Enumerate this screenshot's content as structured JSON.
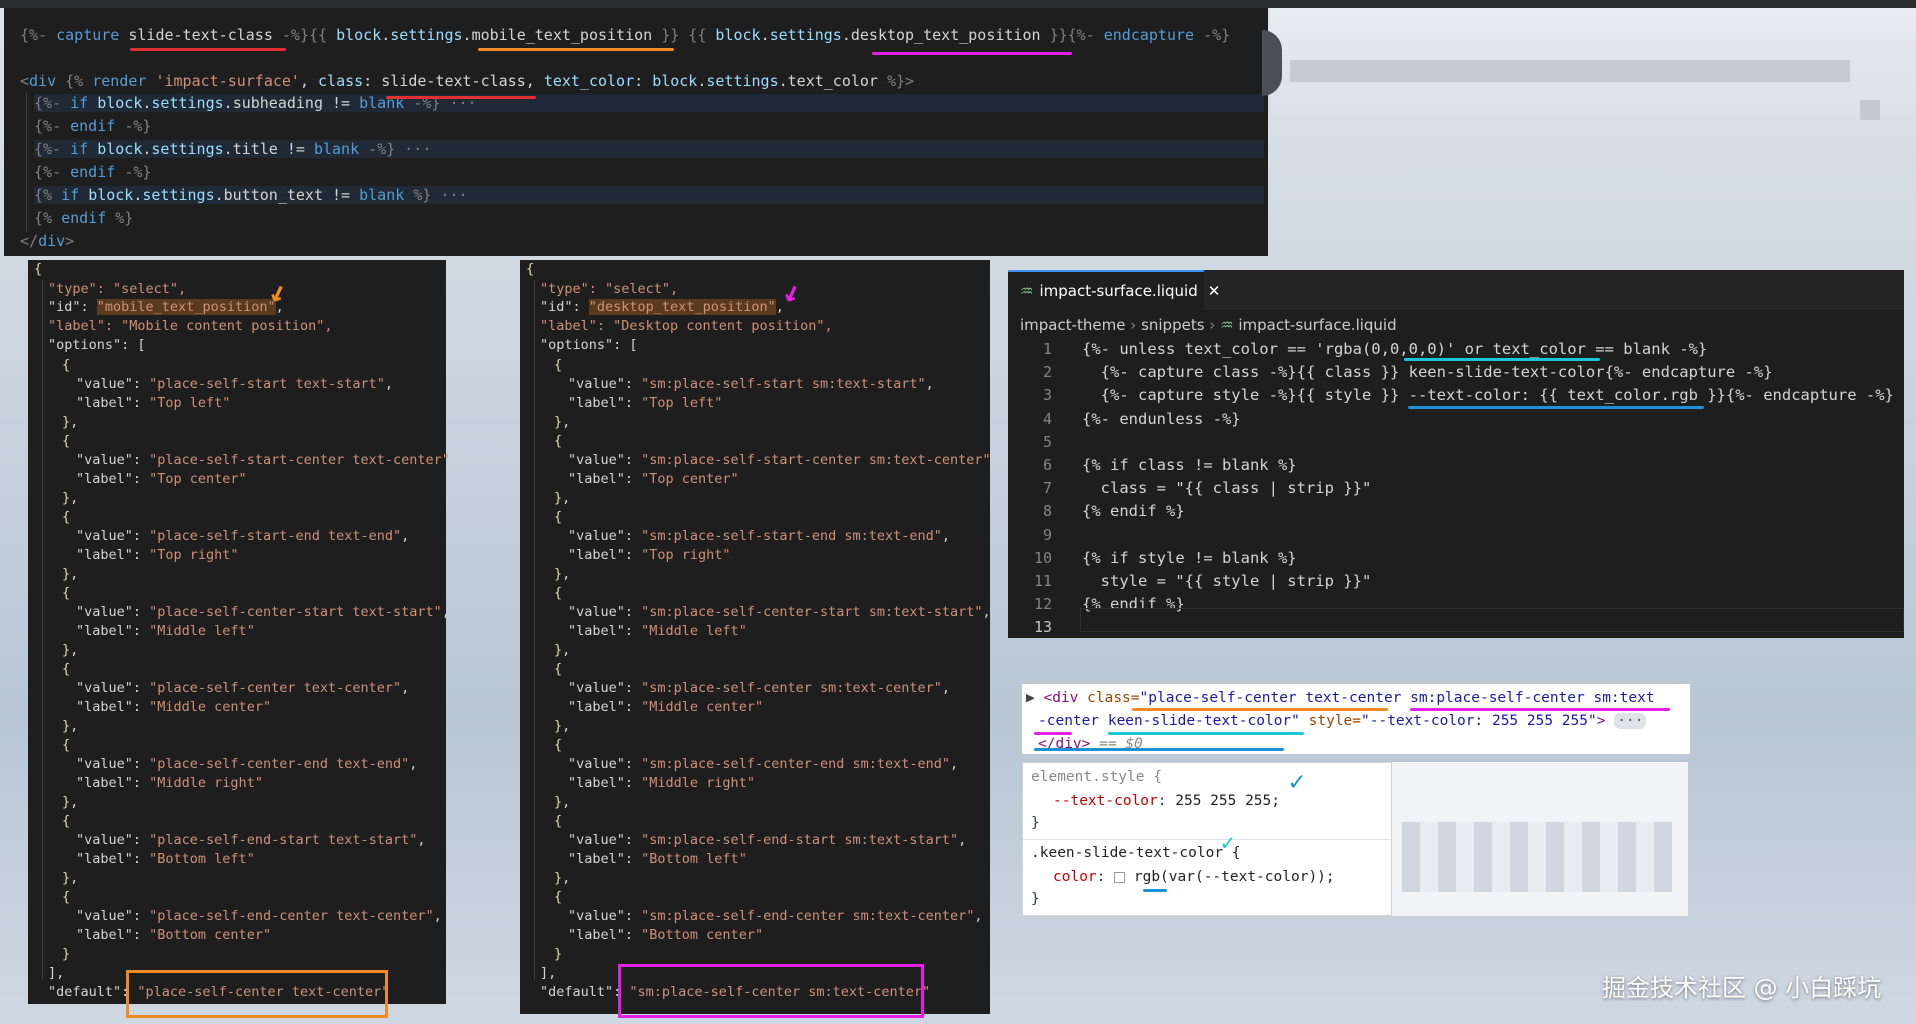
{
  "top_panel": {
    "lines": [
      "{%- capture slide-text-class -%}{{ block.settings.mobile_text_position }} {{ block.settings.desktop_text_position }}{%- endcapture -%}",
      "",
      "<div {% render 'impact-surface', class: slide-text-class, text_color: block.settings.text_color %}>",
      "  {%- if block.settings.subheading != blank -%} ···",
      "  {%- endif -%}",
      "  {%- if block.settings.title != blank -%} ···",
      "  {%- endif -%}",
      "  {% if block.settings.button_text != blank %} ···",
      "  {% endif %}",
      "</div>"
    ]
  },
  "mobile_json": {
    "type_line": "\"type\": \"select\",",
    "id_key": "\"id\": ",
    "id_value": "\"mobile_text_position\"",
    "label_line": "\"label\": \"Mobile content position\",",
    "options_key": "\"options\": [",
    "options": [
      {
        "value": "place-self-start text-start",
        "label": "Top left"
      },
      {
        "value": "place-self-start-center text-center",
        "label": "Top center"
      },
      {
        "value": "place-self-start-end text-end",
        "label": "Top right"
      },
      {
        "value": "place-self-center-start text-start",
        "label": "Middle left"
      },
      {
        "value": "place-self-center text-center",
        "label": "Middle center"
      },
      {
        "value": "place-self-center-end text-end",
        "label": "Middle right"
      },
      {
        "value": "place-self-end-start text-start",
        "label": "Bottom left"
      },
      {
        "value": "place-self-end-center text-center",
        "label": "Bottom center"
      }
    ],
    "default_key": "\"default\": ",
    "default_value": "\"place-self-center text-center\""
  },
  "desktop_json": {
    "type_line": "\"type\": \"select\",",
    "id_key": "\"id\": ",
    "id_value": "\"desktop_text_position\"",
    "label_line": "\"label\": \"Desktop content position\",",
    "options_key": "\"options\": [",
    "options": [
      {
        "value": "sm:place-self-start sm:text-start",
        "label": "Top left"
      },
      {
        "value": "sm:place-self-start-center sm:text-center",
        "label": "Top center"
      },
      {
        "value": "sm:place-self-start-end sm:text-end",
        "label": "Top right"
      },
      {
        "value": "sm:place-self-center-start sm:text-start",
        "label": "Middle left"
      },
      {
        "value": "sm:place-self-center sm:text-center",
        "label": "Middle center"
      },
      {
        "value": "sm:place-self-center-end sm:text-end",
        "label": "Middle right"
      },
      {
        "value": "sm:place-self-end-start sm:text-start",
        "label": "Bottom left"
      },
      {
        "value": "sm:place-self-end-center sm:text-center",
        "label": "Bottom center"
      }
    ],
    "default_key": "\"default\": ",
    "default_value": "\"sm:place-self-center sm:text-center\""
  },
  "editor": {
    "tab_label": "impact-surface.liquid",
    "breadcrumb": {
      "part1": "impact-theme",
      "part2": "snippets",
      "part3": "impact-surface.liquid"
    },
    "line_numbers": [
      "1",
      "2",
      "3",
      "4",
      "5",
      "6",
      "7",
      "8",
      "9",
      "10",
      "11",
      "12",
      "13"
    ],
    "lines": [
      "{%- unless text_color == 'rgba(0,0,0,0)' or text_color == blank -%}",
      "  {%- capture class -%}{{ class }} keen-slide-text-color{%- endcapture -%}",
      "  {%- capture style -%}{{ style }} --text-color: {{ text_color.rgb }}{%- endcapture -%}",
      "{%- endunless -%}",
      "",
      "{% if class != blank %}",
      "  class = \"{{ class | strip }}\"",
      "{% endif %}",
      "",
      "{% if style != blank %}",
      "  style = \"{{ style | strip }}\"",
      "{% endif %}",
      ""
    ]
  },
  "devtools": {
    "line1_tag": "<div ",
    "line1_attr": "class=",
    "line1_val": "\"place-self-center text-center sm:place-self-center sm:text",
    "line2_val": "-center keen-slide-text-color\"",
    "line2_attr": " style=",
    "line2_style": "\"--text-color: 255 255 255\"",
    "line2_end": ">",
    "line2_more": "···",
    "line3": "</div>",
    "line3_sel": "== $0"
  },
  "styles": {
    "selector1": "element.style {",
    "prop1": "--text-color",
    "val1": "255 255 255;",
    "close": "}",
    "selector2": ".keen-slide-text-color {",
    "prop2": "color",
    "val2": "rgb(var(--text-color));"
  },
  "watermark": "掘金技术社区 @ 小白踩坑",
  "colors": {
    "orange": "#f08a24",
    "magenta": "#e61ee6",
    "blue": "#1f8fd6",
    "cyan": "#19c8d8",
    "red": "#e03030"
  }
}
